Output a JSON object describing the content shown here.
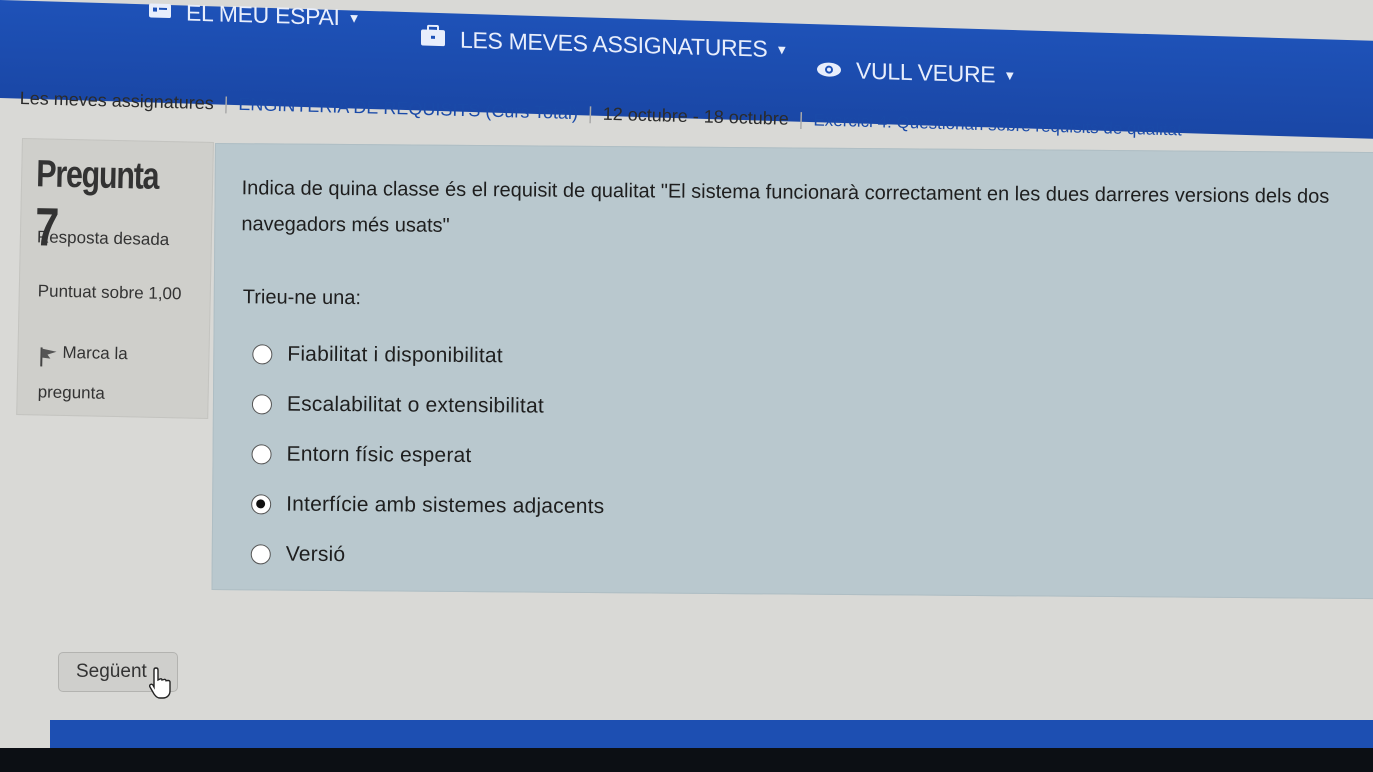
{
  "nav": {
    "item1": "EL MEU ESPAI",
    "item2": "LES MEVES ASSIGNATURES",
    "item3": "VULL VEURE"
  },
  "breadcrumb": [
    "Les meves assignatures",
    "ENGINYERIA DE REQUISITS (Curs Total)",
    "12 octubre - 18 octubre",
    "Exercici 4: Qüestionari sobre requisits de qualitat"
  ],
  "question": {
    "label": "Pregunta",
    "number": "7",
    "state": "Resposta desada",
    "grade": "Puntuat sobre 1,00",
    "flag": "Marca la pregunta",
    "text": "Indica de quina classe és el requisit de qualitat \"El sistema funcionarà correctament en les dues darreres versions dels dos navegadors més usats\"",
    "prompt": "Trieu-ne una:",
    "answers": [
      {
        "label": "Fiabilitat i disponibilitat",
        "checked": false
      },
      {
        "label": "Escalabilitat o extensibilitat",
        "checked": false
      },
      {
        "label": "Entorn físic esperat",
        "checked": false
      },
      {
        "label": "Interfície amb sistemes adjacents",
        "checked": true
      },
      {
        "label": "Versió",
        "checked": false
      }
    ]
  },
  "next_button": "Següent"
}
